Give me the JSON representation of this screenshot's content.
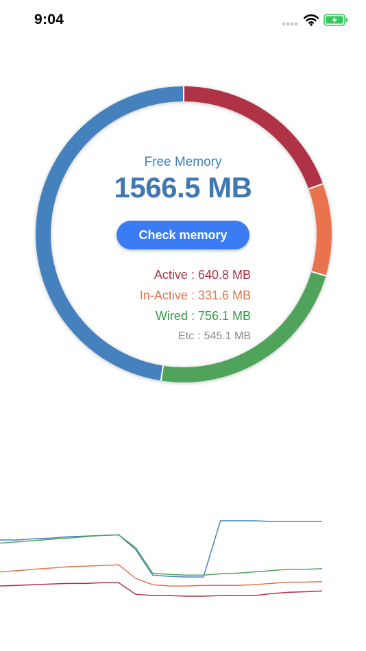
{
  "status_bar": {
    "time": "9:04",
    "icons": [
      "signal-dots-icon",
      "wifi-icon",
      "battery-charging-icon"
    ]
  },
  "colors": {
    "free": "#4581bd",
    "active": "#b03145",
    "inactive": "#e8734d",
    "wired": "#50a35a",
    "etc": "#8a8a8a",
    "button": "#3b7cf4",
    "title": "#3d7fbd"
  },
  "gauge": {
    "free_label": "Free Memory",
    "free_value": "1566.5 MB",
    "segments": [
      {
        "name": "Active",
        "mb": 640.8
      },
      {
        "name": "In-Active",
        "mb": 331.6
      },
      {
        "name": "Wired",
        "mb": 756.1
      },
      {
        "name": "Free",
        "mb": 1566.5
      }
    ]
  },
  "button": {
    "label": "Check memory"
  },
  "stats": {
    "active": {
      "label": "Active",
      "value": "640.8 MB"
    },
    "inactive": {
      "label": "In-Active",
      "value": "331.6 MB"
    },
    "wired": {
      "label": "Wired",
      "value": "756.1 MB"
    },
    "etc": {
      "label": "Etc",
      "value": "545.1 MB"
    },
    "separator": ":"
  },
  "chart_data": {
    "type": "line",
    "title": "",
    "xlabel": "",
    "ylabel": "",
    "grid": false,
    "x": [
      0,
      1,
      2,
      3,
      4,
      5,
      6,
      7,
      8,
      9,
      10,
      11,
      12,
      13,
      14,
      15,
      16,
      17,
      18,
      19
    ],
    "series": [
      {
        "color": "#4581bd",
        "values": [
          1560,
          1560,
          1562,
          1563,
          1565,
          1566,
          1567,
          1568,
          1545,
          1505,
          1503,
          1502,
          1502,
          1590,
          1590,
          1590,
          1589,
          1589,
          1589,
          1589
        ]
      },
      {
        "color": "#50a35a",
        "values": [
          1555,
          1557,
          1559,
          1561,
          1563,
          1565,
          1567,
          1568,
          1548,
          1508,
          1506,
          1505,
          1505,
          1507,
          1508,
          1510,
          1512,
          1514,
          1514,
          1515
        ]
      },
      {
        "color": "#e8734d",
        "values": [
          1510,
          1512,
          1514,
          1516,
          1518,
          1519,
          1520,
          1521,
          1500,
          1490,
          1488,
          1488,
          1489,
          1489,
          1489,
          1490,
          1492,
          1494,
          1494,
          1495
        ]
      },
      {
        "color": "#b03145",
        "values": [
          1488,
          1489,
          1490,
          1491,
          1492,
          1492,
          1493,
          1493,
          1475,
          1473,
          1473,
          1472,
          1472,
          1473,
          1473,
          1473,
          1476,
          1478,
          1479,
          1480
        ]
      }
    ]
  }
}
